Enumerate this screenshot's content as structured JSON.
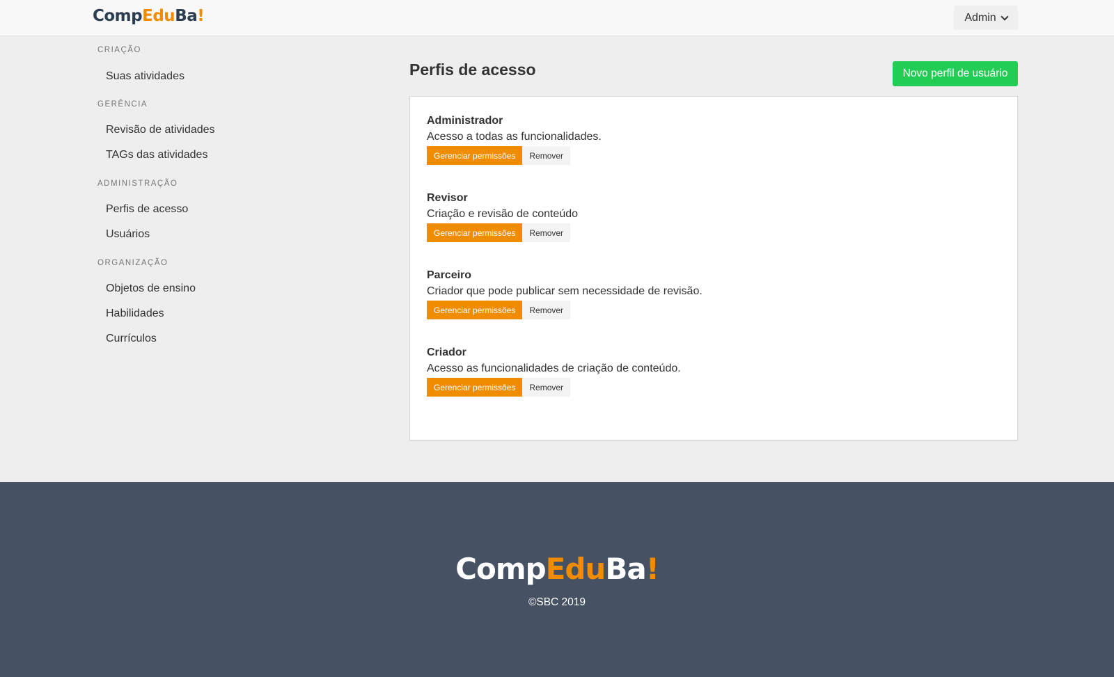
{
  "brand": {
    "part1": "Comp",
    "part2": "Edu",
    "part3": "Ba",
    "part4": "!",
    "color_dark": "#2c3e50",
    "color_accent": "#f08c00"
  },
  "header": {
    "user_menu_label": "Admin",
    "user_menu_icon": "chevron-down-icon"
  },
  "sidebar": {
    "sections": [
      {
        "title": "CRIAÇÃO",
        "items": [
          "Suas atividades"
        ]
      },
      {
        "title": "GERÊNCIA",
        "items": [
          "Revisão de atividades",
          "TAGs das atividades"
        ]
      },
      {
        "title": "ADMINISTRAÇÃO",
        "items": [
          "Perfis de acesso",
          "Usuários"
        ]
      },
      {
        "title": "ORGANIZAÇÃO",
        "items": [
          "Objetos de ensino",
          "Habilidades",
          "Currículos"
        ]
      }
    ]
  },
  "main": {
    "title": "Perfis de acesso",
    "new_button_label": "Novo perfil de usuário",
    "profiles": [
      {
        "name": "Administrador",
        "description": "Acesso a todas as funcionalidades.",
        "manage_label": "Gerenciar permissões",
        "remove_label": "Remover"
      },
      {
        "name": "Revisor",
        "description": "Criação e revisão de conteúdo",
        "manage_label": "Gerenciar permissões",
        "remove_label": "Remover"
      },
      {
        "name": "Parceiro",
        "description": "Criador que pode publicar sem necessidade de revisão.",
        "manage_label": "Gerenciar permissões",
        "remove_label": "Remover"
      },
      {
        "name": "Criador",
        "description": "Acesso as funcionalidades de criação de conteúdo.",
        "manage_label": "Gerenciar permissões",
        "remove_label": "Remover"
      }
    ]
  },
  "footer": {
    "copyright": "©SBC 2019",
    "background": "#465263"
  },
  "colors": {
    "primary_green": "#22cc55",
    "orange": "#f08c00"
  }
}
